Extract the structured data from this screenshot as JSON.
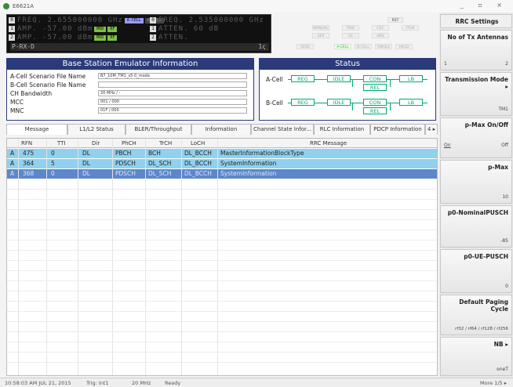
{
  "window": {
    "title": "E6621A"
  },
  "lcd": {
    "rows": [
      {
        "idx": "0",
        "text": "FREQ. 2.655000000 GHz",
        "tags": [
          "A-CELL",
          "B-CELL"
        ]
      },
      {
        "idx": "1",
        "text": "AMP.        -57.00 dBm",
        "tags": [
          "MOD",
          "RF"
        ]
      },
      {
        "idx": "2",
        "text": "AMP.        -57.00 dBm",
        "tags": [
          "MOD",
          "RF"
        ]
      }
    ],
    "rows_right": [
      {
        "idx": "0",
        "text": "FREQ. 2.535000000 GHz"
      },
      {
        "idx": "1",
        "text": "ATTEN.          60 dB"
      },
      {
        "idx": "2",
        "text": "ATTEN."
      }
    ],
    "bar_text": "P-RX-D",
    "bar_value": "1ς"
  },
  "top_buttons": {
    "rst": "RST",
    "row1": [
      "MANUAL",
      "TRAF",
      "CEC",
      "ITEM"
    ],
    "row2": [
      "SEP",
      "CE",
      "HRS"
    ],
    "row3": [
      "SCRE",
      "A-CELL",
      "B-CELL",
      "SINGLE",
      "HOLD"
    ]
  },
  "info_panel": {
    "title": "Base Station Emulator Information",
    "rows": [
      {
        "label": "A-Cell Scenario File Name",
        "value": "B7_10M_TM1_v5.0_mode"
      },
      {
        "label": "B-Cell Scenario File Name",
        "value": ""
      },
      {
        "label": "CH Bandwidth",
        "value": "20 MHz / -"
      },
      {
        "label": "MCC",
        "value": "001 / 000"
      },
      {
        "label": "MNC",
        "value": "01F / 000"
      }
    ]
  },
  "status_panel": {
    "title": "Status",
    "cells": [
      {
        "label": "A-Cell",
        "states": [
          "REG",
          "IDLE",
          "CON",
          "LB",
          "REL"
        ]
      },
      {
        "label": "B-Cell",
        "states": [
          "REG",
          "IDLE",
          "CON",
          "LB",
          "REL"
        ]
      }
    ]
  },
  "tabs": [
    "Message",
    "L1/L2 Status",
    "BLER/Throughput",
    "Information",
    "Channel State Infor...",
    "RLC Information",
    "PDCP Information",
    "4 ▸"
  ],
  "table": {
    "columns": [
      "RFN",
      "TTI",
      "Dir",
      "PhCH",
      "TrCH",
      "LoCH",
      "RRC Message"
    ],
    "rows": [
      {
        "cell": "A",
        "rfn": "475",
        "tti": "0",
        "dir": "DL",
        "phch": "PBCH",
        "trch": "BCH",
        "loch": "DL_BCCH",
        "msg": "MasterInformationBlockType"
      },
      {
        "cell": "A",
        "rfn": "364",
        "tti": "5",
        "dir": "DL",
        "phch": "PDSCH",
        "trch": "DL_SCH",
        "loch": "DL_BCCH",
        "msg": "SystemInformation"
      },
      {
        "cell": "A",
        "rfn": "368",
        "tti": "0",
        "dir": "DL",
        "phch": "PDSCH",
        "trch": "DL_SCH",
        "loch": "DL_BCCH",
        "msg": "SystemInformation"
      }
    ]
  },
  "status_bar": {
    "time": "10:58:03 AM JUL 21, 2015",
    "trig": "Trig: Int1",
    "bw": "20 MHz",
    "ready": "Ready",
    "more": "More 1/5 ▸"
  },
  "side_panel": {
    "title": "RRC Settings",
    "keys": [
      {
        "title": "No of Tx Antennas",
        "left": "1",
        "right": "2"
      },
      {
        "title": "Transmission Mode ▸",
        "left": "",
        "right": "TM1"
      },
      {
        "title": "p-Max On/Off",
        "left": "On",
        "right": "Off"
      },
      {
        "title": "p-Max",
        "left": "",
        "right": "10"
      },
      {
        "title": "p0-NominalPUSCH",
        "left": "",
        "right": "-85"
      },
      {
        "title": "p0-UE-PUSCH",
        "left": "",
        "right": "0"
      },
      {
        "title": "Default Paging Cycle",
        "left": "",
        "right": "rf32 / rf64 / rf128 / rf256"
      },
      {
        "title": "NB ▸",
        "left": "",
        "right": "oneT"
      }
    ]
  },
  "colors": {
    "panel_header": "#2a3a7a",
    "row_selected_light": "#8fd1ef",
    "row_selected_dark": "#5e87c9",
    "status_green": "#00aa77"
  }
}
